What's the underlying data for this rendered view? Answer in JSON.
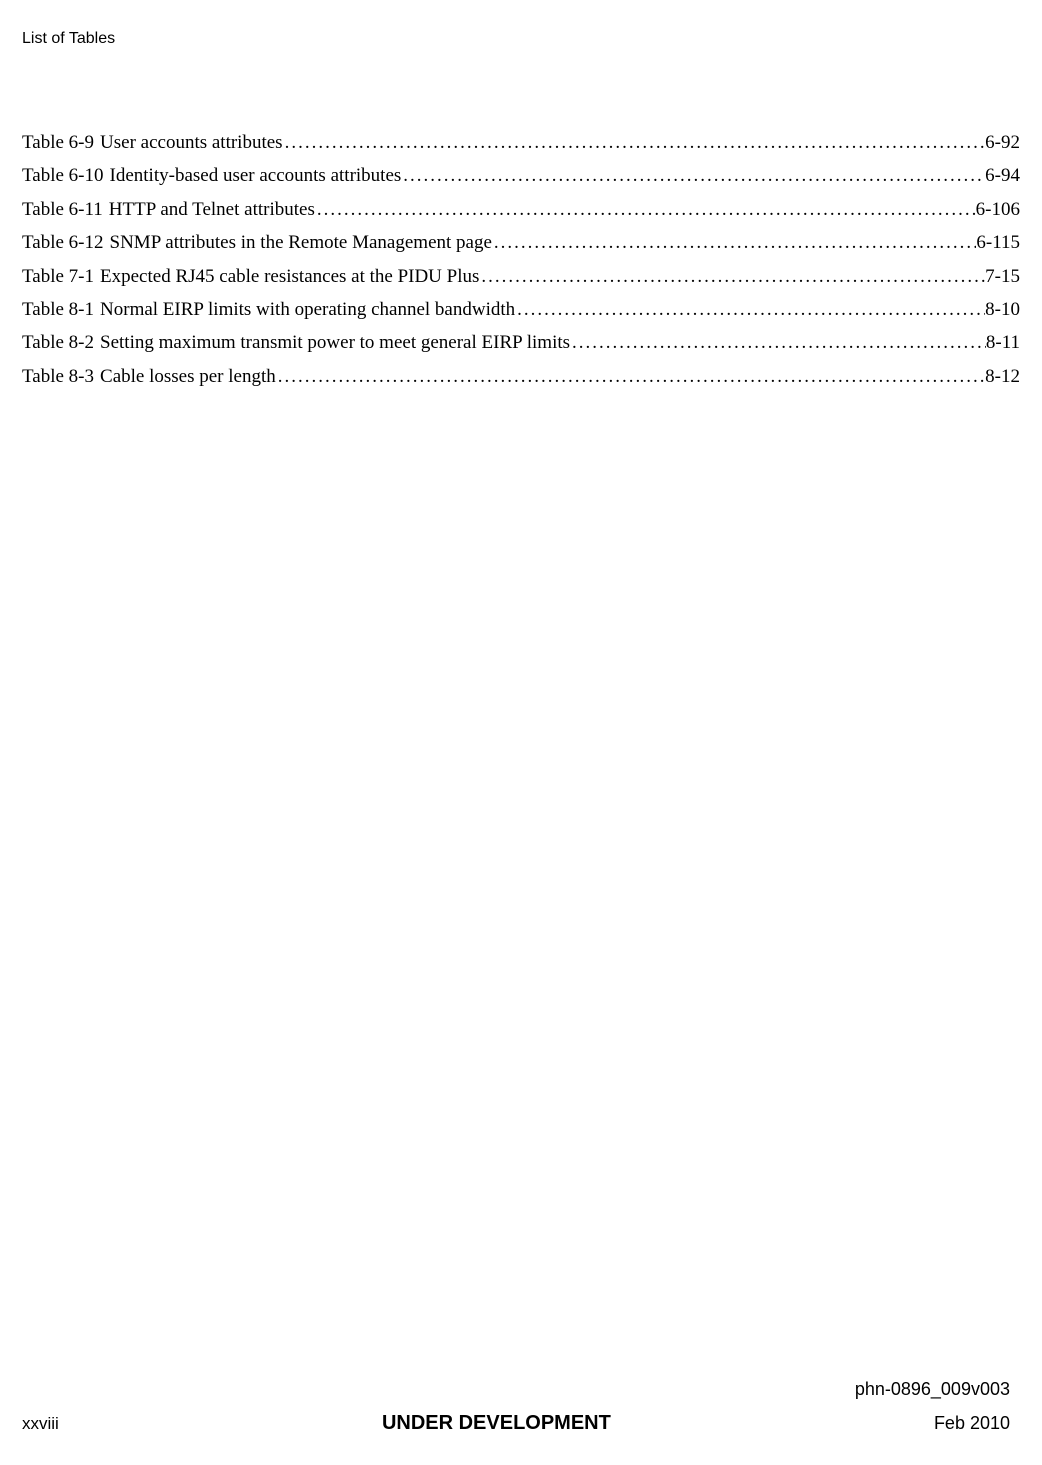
{
  "header": {
    "title": "List of Tables"
  },
  "toc": [
    {
      "label": "Table 6-9",
      "title": "User accounts attributes",
      "page": "6-92"
    },
    {
      "label": "Table 6-10",
      "title": "Identity-based user accounts attributes",
      "page": "6-94"
    },
    {
      "label": "Table 6-11",
      "title": "HTTP and Telnet attributes",
      "page": "6-106"
    },
    {
      "label": "Table 6-12",
      "title": "SNMP attributes in the Remote Management page",
      "page": "6-115"
    },
    {
      "label": "Table 7-1",
      "title": "Expected RJ45 cable resistances at the PIDU Plus",
      "page": "7-15"
    },
    {
      "label": "Table 8-1",
      "title": "Normal EIRP limits with operating channel bandwidth",
      "page": "8-10"
    },
    {
      "label": "Table 8-2",
      "title": "Setting maximum transmit power to meet general EIRP limits",
      "page": "8-11"
    },
    {
      "label": "Table 8-3",
      "title": "Cable losses per length",
      "page": "8-12"
    }
  ],
  "footer": {
    "docref": "phn-0896_009v003",
    "pagenum": "xxviii",
    "status": "UNDER DEVELOPMENT",
    "date": "Feb 2010"
  }
}
